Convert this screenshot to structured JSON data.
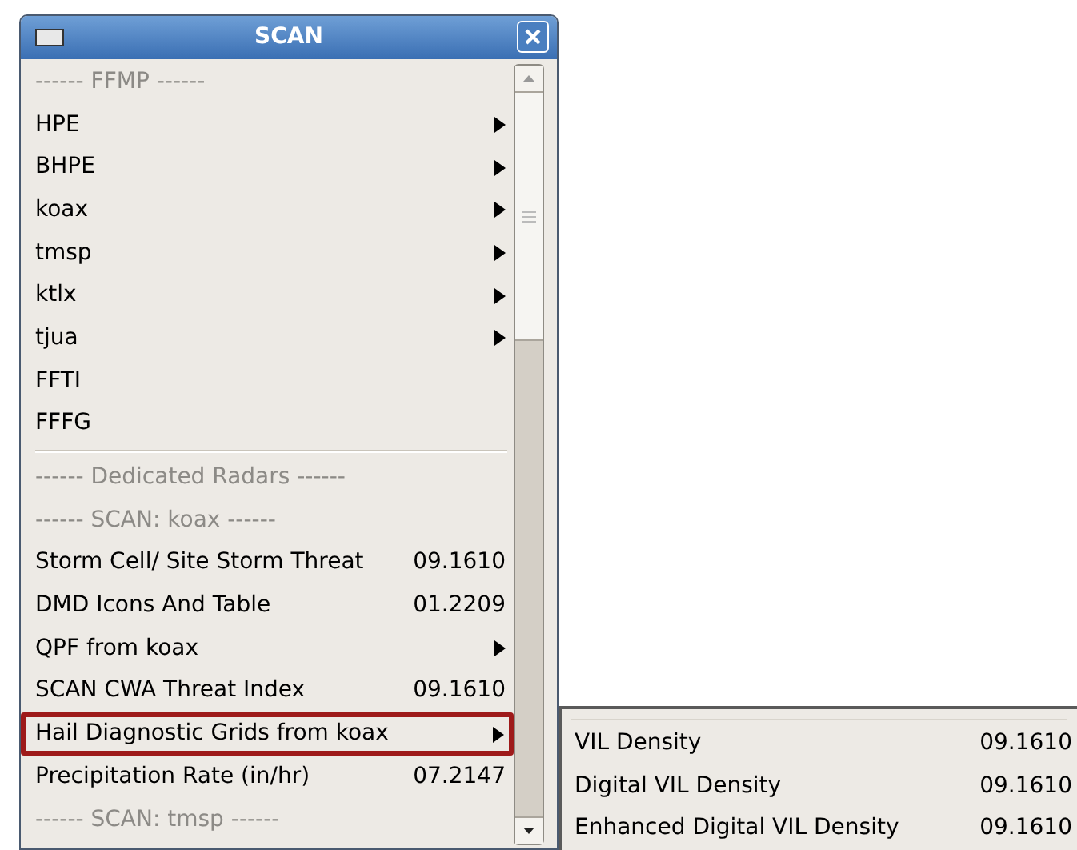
{
  "window": {
    "title": "SCAN"
  },
  "menu": {
    "items": [
      {
        "kind": "header",
        "label": "------ FFMP ------",
        "outlined": false
      },
      {
        "kind": "submenu",
        "label": "HPE",
        "outlined": false
      },
      {
        "kind": "submenu",
        "label": "BHPE",
        "outlined": false
      },
      {
        "kind": "submenu",
        "label": "koax",
        "outlined": false
      },
      {
        "kind": "submenu",
        "label": "tmsp",
        "outlined": false
      },
      {
        "kind": "submenu",
        "label": "ktlx",
        "outlined": false
      },
      {
        "kind": "submenu",
        "label": "tjua",
        "outlined": false
      },
      {
        "kind": "plain",
        "label": "FFTI",
        "outlined": false
      },
      {
        "kind": "plain",
        "label": "FFFG",
        "outlined": false
      },
      {
        "kind": "separator"
      },
      {
        "kind": "header",
        "label": "------ Dedicated Radars ------",
        "outlined": false
      },
      {
        "kind": "header",
        "label": "------ SCAN: koax ------",
        "outlined": false
      },
      {
        "kind": "value",
        "label": "Storm Cell/ Site Storm Threat",
        "value": "09.1610",
        "outlined": false
      },
      {
        "kind": "value",
        "label": "DMD Icons And Table",
        "value": "01.2209",
        "outlined": false
      },
      {
        "kind": "submenu",
        "label": "QPF from koax",
        "outlined": false
      },
      {
        "kind": "value",
        "label": "SCAN CWA Threat Index",
        "value": "09.1610",
        "outlined": false
      },
      {
        "kind": "submenu",
        "label": "Hail Diagnostic Grids from koax",
        "outlined": true
      },
      {
        "kind": "value",
        "label": "Precipitation Rate (in/hr)",
        "value": "07.2147",
        "outlined": false
      },
      {
        "kind": "header",
        "label": "------ SCAN: tmsp ------",
        "outlined": false
      }
    ]
  },
  "submenu": {
    "items": [
      {
        "kind": "value",
        "label": "VIL Density",
        "value": "09.1610"
      },
      {
        "kind": "value",
        "label": "Digital VIL Density",
        "value": "09.1610"
      },
      {
        "kind": "value",
        "label": "Enhanced Digital VIL Density",
        "value": "09.1610"
      }
    ]
  }
}
